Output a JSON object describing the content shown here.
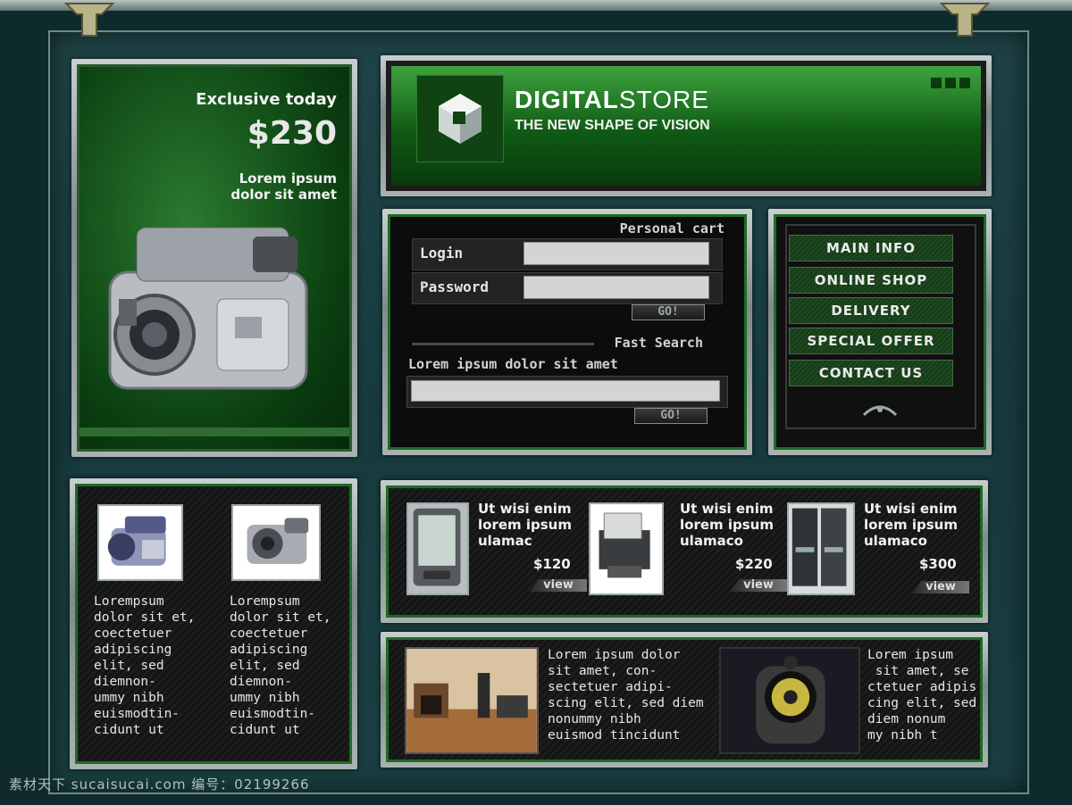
{
  "promo": {
    "title": "Exclusive today",
    "price": "$230",
    "line1": "Lorem ipsum",
    "line2": "dolor sit amet"
  },
  "header": {
    "brand_bold": "DIGITAL",
    "brand_light": "STORE",
    "tagline": "THE NEW SHAPE OF  VISION"
  },
  "cart": {
    "title": "Personal cart",
    "login_label": "Login",
    "password_label": "Password",
    "go_label": "GO!"
  },
  "search": {
    "title": "Fast Search",
    "caption": "Lorem ipsum dolor sit amet",
    "go_label": "GO!"
  },
  "menu": {
    "items": [
      "MAIN INFO",
      "ONLINE SHOP",
      "DELIVERY",
      "SPECIAL OFFER",
      "CONTACT US"
    ]
  },
  "left_products": [
    {
      "text": [
        "Lorempsum",
        "dolor sit et,",
        "coectetuer",
        "adipiscing",
        "elit, sed",
        "diemnon-",
        "ummy nibh",
        "euismodtin-",
        "cidunt ut"
      ]
    },
    {
      "text": [
        "Lorempsum",
        "dolor sit et,",
        "coectetuer",
        "adipiscing",
        "elit, sed",
        "diemnon-",
        "ummy nibh",
        "euismodtin-",
        "cidunt ut"
      ]
    }
  ],
  "products": [
    {
      "line1": "Ut wisi enim",
      "line2": "lorem ipsum",
      "line3": "ulamac",
      "price": "$120",
      "view": "view"
    },
    {
      "line1": "Ut wisi enim",
      "line2": "lorem ipsum",
      "line3": "ulamaco",
      "price": "$220",
      "view": "view"
    },
    {
      "line1": "Ut wisi enim",
      "line2": "lorem ipsum",
      "line3": "ulamaco",
      "price": "$300",
      "view": "view"
    }
  ],
  "bottom": {
    "text1": [
      "Lorem ipsum dolor",
      "sit amet, con-",
      "sectetuer adipi-",
      "scing elit, sed diem",
      "nonummy nibh",
      "euismod tincidunt"
    ],
    "text2": [
      "Lorem ipsum",
      " sit amet, se",
      "ctetuer adipis",
      "cing elit, sed",
      "diem nonum",
      "my nibh t"
    ]
  },
  "watermark": "素材天下 sucaisucai.com  编号：02199266",
  "colors": {
    "accent_green": "#1d6b25",
    "frame_teal": "#1f4447"
  }
}
